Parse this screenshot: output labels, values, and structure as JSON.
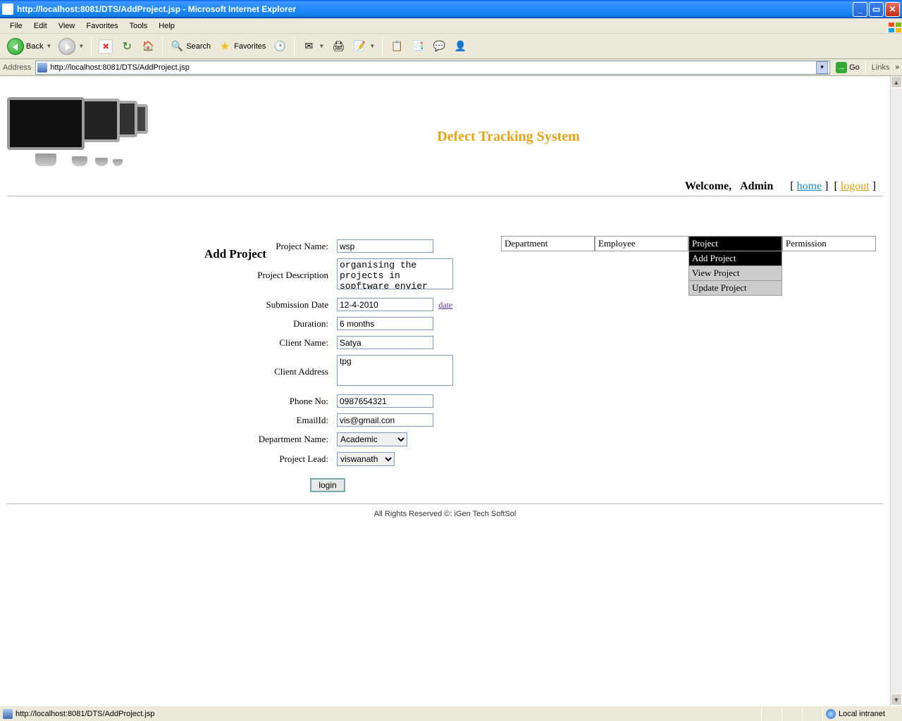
{
  "window": {
    "title": "http://localhost:8081/DTS/AddProject.jsp - Microsoft Internet Explorer"
  },
  "menu": {
    "file": "File",
    "edit": "Edit",
    "view": "View",
    "favorites": "Favorites",
    "tools": "Tools",
    "help": "Help"
  },
  "toolbar": {
    "back": "Back",
    "search": "Search",
    "favorites": "Favorites"
  },
  "address": {
    "label": "Address",
    "url": "http://localhost:8081/DTS/AddProject.jsp",
    "go": "Go",
    "links": "Links"
  },
  "header": {
    "app_title": "Defect Tracking System",
    "welcome": "Welcome,",
    "user": "Admin",
    "home": "home",
    "logout": "logout"
  },
  "nav": {
    "department": "Department",
    "employee": "Employee",
    "project": "Project",
    "permission": "Permission",
    "add_project": "Add Project",
    "view_project": "View Project",
    "update_project": "Update Project"
  },
  "form": {
    "heading": "Add Project",
    "labels": {
      "project_name": "Project Name:",
      "project_description": "Project Description",
      "submission_date": "Submission Date",
      "duration": "Duration:",
      "client_name": "Client Name:",
      "client_address": "Client Address",
      "phone_no": "Phone No:",
      "email_id": "EmailId:",
      "department_name": "Department Name:",
      "project_lead": "Project Lead:"
    },
    "values": {
      "project_name": "wsp",
      "project_description": "organising the projects in sopftware envier",
      "submission_date": "12-4-2010",
      "duration": "6 months",
      "client_name": "Satya",
      "client_address": "tpg",
      "phone_no": "0987654321",
      "email_id": "vis@gmail.con",
      "department_name": "Academic",
      "project_lead": "viswanath"
    },
    "date_link": "date",
    "submit": "login"
  },
  "footer": "All Rights Reserved ©: iGen Tech SoftSol",
  "status": {
    "url": "http://localhost:8081/DTS/AddProject.jsp",
    "zone": "Local intranet"
  }
}
